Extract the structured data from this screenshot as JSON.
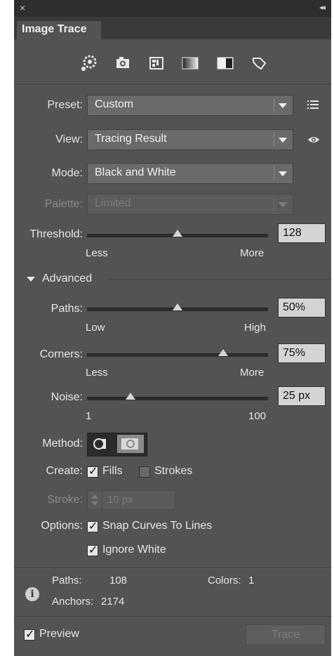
{
  "panel": {
    "title": "Image Trace"
  },
  "preset": {
    "label": "Preset:",
    "value": "Custom"
  },
  "view": {
    "label": "View:",
    "value": "Tracing Result"
  },
  "mode": {
    "label": "Mode:",
    "value": "Black and White"
  },
  "palette": {
    "label": "Palette:",
    "value": "Limited"
  },
  "threshold": {
    "label": "Threshold:",
    "value": "128",
    "min_label": "Less",
    "max_label": "More",
    "level": 0.5
  },
  "advanced": {
    "label": "Advanced"
  },
  "paths": {
    "label": "Paths:",
    "value": "50%",
    "min_label": "Low",
    "max_label": "High",
    "level": 0.5
  },
  "corners": {
    "label": "Corners:",
    "value": "75%",
    "min_label": "Less",
    "max_label": "More",
    "level": 0.75
  },
  "noise": {
    "label": "Noise:",
    "value": "25 px",
    "min_label": "1",
    "max_label": "100",
    "level": 0.24
  },
  "method": {
    "label": "Method:"
  },
  "create": {
    "label": "Create:",
    "fills": "Fills",
    "strokes": "Strokes",
    "fills_checked": true,
    "strokes_checked": false
  },
  "stroke": {
    "label": "Stroke:",
    "value": "10 px"
  },
  "options": {
    "label": "Options:",
    "snap": "Snap Curves To Lines",
    "ignore_white": "Ignore White"
  },
  "stats": {
    "paths_label": "Paths:",
    "paths_value": "108",
    "colors_label": "Colors:",
    "colors_value": "1",
    "anchors_label": "Anchors:",
    "anchors_value": "2174"
  },
  "footer": {
    "preview": "Preview",
    "trace": "Trace"
  },
  "icons": {
    "close": "close-icon",
    "collapse": "collapse-icon",
    "presets": [
      "auto-color-icon",
      "high-color-icon",
      "low-color-icon",
      "grayscale-icon",
      "black-white-icon",
      "outline-icon"
    ],
    "preset_menu": "list-menu-icon",
    "view_eye": "eye-icon",
    "info": "info-icon"
  },
  "colors": {
    "panel_bg": "#535353",
    "field_bg": "#d4d4d4",
    "tab_bar": "#3a3a3a"
  }
}
